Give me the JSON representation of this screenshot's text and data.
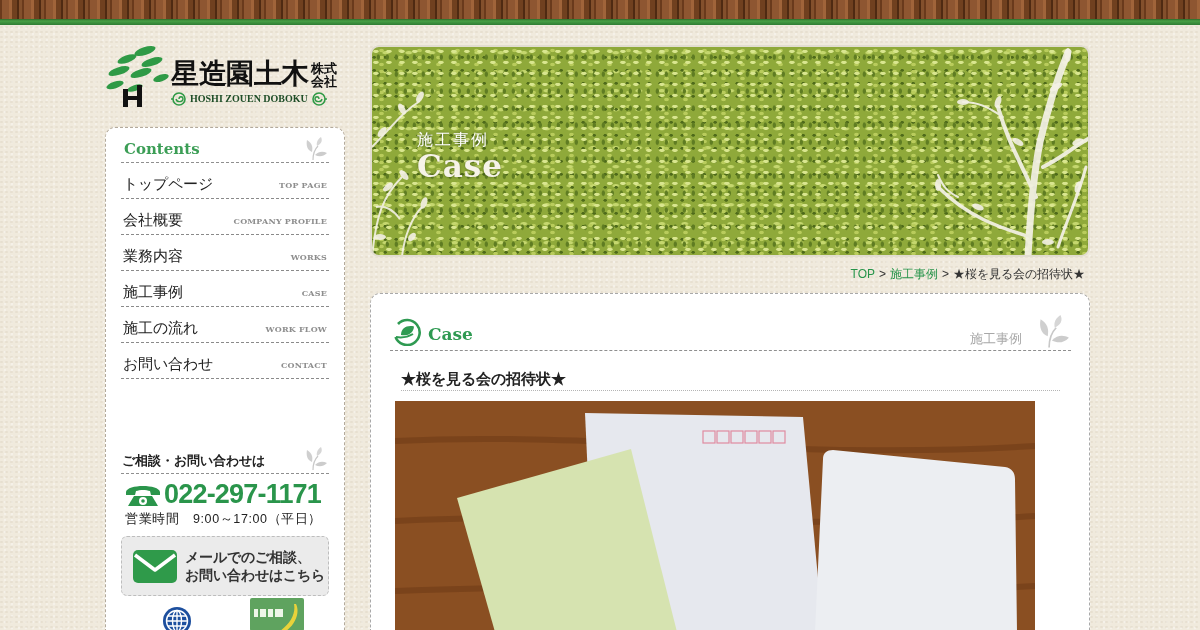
{
  "header": {
    "logo": {
      "name": "星造園土木",
      "corp_type": "株式会社",
      "romaji": "HOSHI ZOUEN DOBOKU"
    }
  },
  "sidebar": {
    "title": "Contents",
    "menu": [
      {
        "label": "トップページ",
        "sublabel": "TOP PAGE"
      },
      {
        "label": "会社概要",
        "sublabel": "COMPANY PROFILE"
      },
      {
        "label": "業務内容",
        "sublabel": "WORKS"
      },
      {
        "label": "施工事例",
        "sublabel": "CASE"
      },
      {
        "label": "施工の流れ",
        "sublabel": "WORK FLOW"
      },
      {
        "label": "お問い合わせ",
        "sublabel": "CONTACT"
      }
    ],
    "contact": {
      "heading": "ご相談・お問い合わせは",
      "phone": "022-297-1171",
      "hours": "営業時間　9:00～17:00（平日）",
      "mail_button": [
        "メールでのご相談、",
        "お問い合わせはこちら"
      ]
    }
  },
  "banner": {
    "subtitle": "施工事例",
    "title": "Case"
  },
  "breadcrumb": {
    "separator": ">",
    "items": [
      {
        "label": "TOP",
        "kind": "link"
      },
      {
        "label": "施工事例",
        "kind": "link"
      },
      {
        "label": "★桜を見る会の招待状★",
        "kind": "current"
      }
    ]
  },
  "content": {
    "section_title": "Case",
    "section_subtitle": "施工事例",
    "post_title": "★桜を見る会の招待状★"
  }
}
